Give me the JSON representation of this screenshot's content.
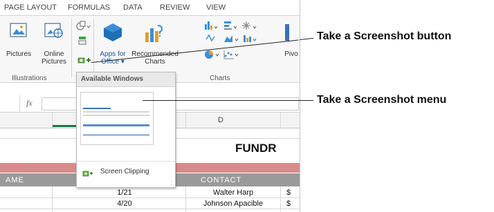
{
  "ribbon_tabs": [
    "PAGE LAYOUT",
    "FORMULAS",
    "DATA",
    "REVIEW",
    "VIEW"
  ],
  "ribbon": {
    "pictures": "Pictures",
    "online_pictures_l1": "Online",
    "online_pictures_l2": "Pictures",
    "apps_l1": "Apps for",
    "apps_l2": "Office",
    "recommended_l1": "Recommended",
    "recommended_l2": "Charts",
    "pivot": "Pivo",
    "group_illustrations": "Illustrations",
    "group_charts": "Charts"
  },
  "formula_bar": {
    "fx": "fx"
  },
  "sheet": {
    "column_d": "D",
    "title": "FUNDR",
    "header_left": "AME",
    "header_contact": "CONTACT",
    "rows": [
      {
        "date": "1/21",
        "contact": "Walter Harp",
        "amount": "$"
      },
      {
        "date": "4/20",
        "contact": "Johnson Apacible",
        "amount": "$"
      }
    ]
  },
  "screenshot_menu": {
    "header": "Available Windows",
    "screen_clipping": "Screen Clipping"
  },
  "callouts": {
    "button": "Take a Screenshot button",
    "menu": "Take a Screenshot menu"
  },
  "colors": {
    "header_band": "#9a9a9a",
    "pink_band": "#d98b8b",
    "apps_blue": "#1f6fb5",
    "excel_green": "#217346"
  },
  "icons": [
    "pictures-icon",
    "online-pictures-icon",
    "shapes-icon",
    "smartart-icon",
    "screenshot-icon",
    "apps-for-office-icon",
    "recommended-charts-icon",
    "chart-type-icons",
    "screen-clipping-icon",
    "resize-grip-icon"
  ]
}
